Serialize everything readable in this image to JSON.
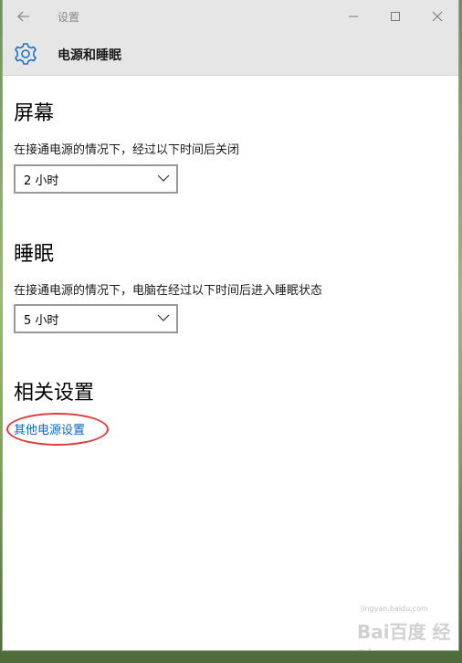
{
  "window": {
    "title": "设置",
    "controls": {
      "back_icon": "back-arrow-icon",
      "minimize_icon": "minimize-icon",
      "maximize_icon": "maximize-icon",
      "close_icon": "close-icon"
    }
  },
  "header": {
    "icon": "gear-icon",
    "title": "电源和睡眠"
  },
  "screen": {
    "title": "屏幕",
    "description": "在接通电源的情况下，经过以下时间后关闭",
    "selected": "2 小时"
  },
  "sleep": {
    "title": "睡眠",
    "description": "在接通电源的情况下，电脑在经过以下时间后进入睡眠状态",
    "selected": "5 小时"
  },
  "related": {
    "title": "相关设置",
    "link": "其他电源设置",
    "annotation_color": "#e03a3a"
  },
  "watermark": {
    "logo": "Bai百度 经验",
    "url": "jingyan.baidu.com"
  },
  "colors": {
    "accent": "#0a66c2",
    "titlebar_bg": "#e6e6e6"
  }
}
